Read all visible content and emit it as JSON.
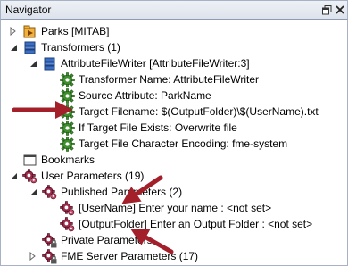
{
  "window": {
    "title": "Navigator"
  },
  "tree": {
    "parks": "Parks [MITAB]",
    "transformers": "Transformers (1)",
    "attribute_file_writer": "AttributeFileWriter [AttributeFileWriter:3]",
    "transformer_name": "Transformer Name: AttributeFileWriter",
    "source_attribute": "Source Attribute: ParkName",
    "target_filename": "Target Filename: $(OutputFolder)\\$(UserName).txt",
    "if_target_exists": "If Target File Exists: Overwrite file",
    "target_encoding": "Target File Character Encoding: fme-system",
    "bookmarks": "Bookmarks",
    "user_parameters": "User Parameters (19)",
    "published_parameters": "Published Parameters (2)",
    "username_param": "[UserName] Enter your name : <not set>",
    "outputfolder_param": "[OutputFolder] Enter an Output Folder : <not set>",
    "private_parameters": "Private Parameters",
    "fme_server_parameters": "FME Server Parameters (17)"
  },
  "colors": {
    "annotation_arrow": "#a3202a",
    "gear": "#3f8f2e",
    "param_gear": "#9c2a4a"
  }
}
